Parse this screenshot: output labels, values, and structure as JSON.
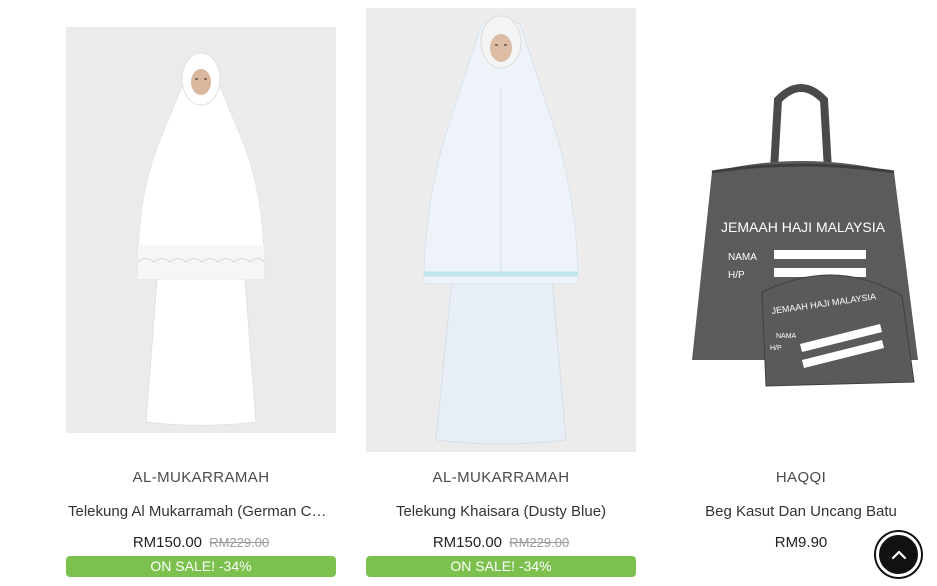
{
  "products": [
    {
      "brand": "AL-MUKARRAMAH",
      "title": "Telekung Al Mukarramah (German Cot...",
      "price": "RM150.00",
      "old_price": "RM229.00",
      "badge": "ON SALE! -34%"
    },
    {
      "brand": "AL-MUKARRAMAH",
      "title": "Telekung Khaisara (Dusty Blue)",
      "price": "RM150.00",
      "old_price": "RM229.00",
      "badge": "ON SALE! -34%"
    },
    {
      "brand": "HAQQI",
      "title": "Beg Kasut Dan Uncang Batu",
      "price": "RM9.90",
      "bag_text": "JEMAAH HAJI MALAYSIA",
      "bag_nama": "NAMA",
      "bag_hp": "H/P",
      "pouch_text": "JEMAAH HAJI MALAYSIA",
      "pouch_nama": "NAMA",
      "pouch_hp": "H/P"
    }
  ],
  "colors": {
    "sale_badge": "#7cc14e",
    "back_to_top": "#111111"
  },
  "icons": {
    "back_to_top": "chevron-up-icon"
  }
}
